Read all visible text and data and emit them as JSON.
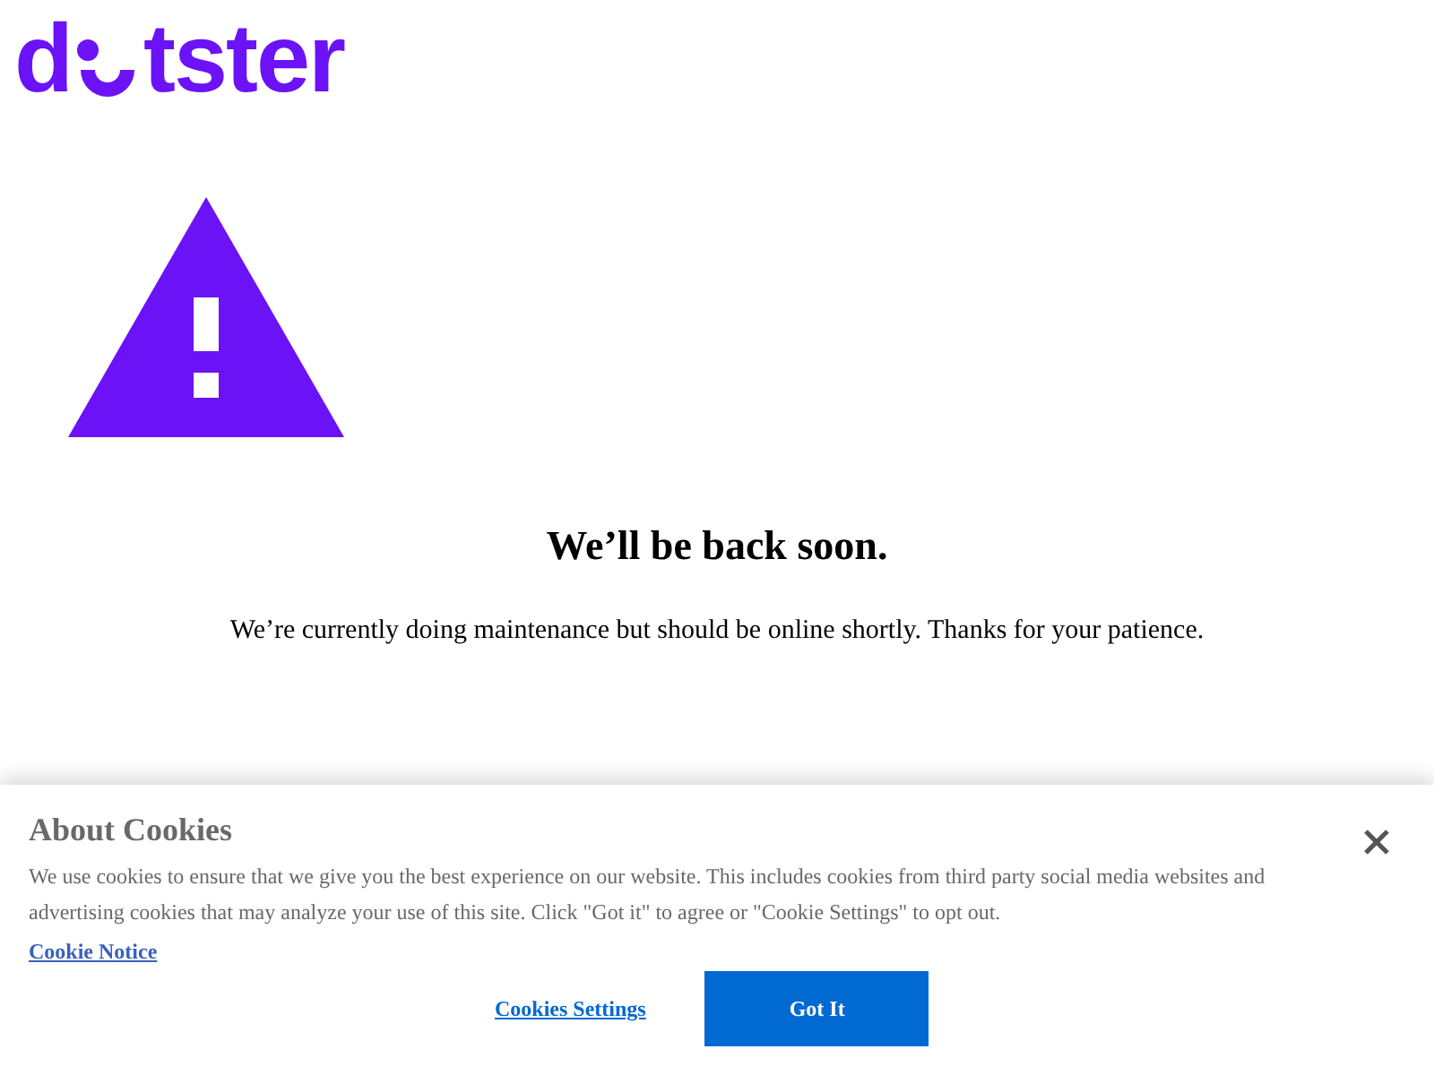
{
  "logo": {
    "before": "d",
    "after": "tster"
  },
  "heading": "We’ll be back soon.",
  "message": "We’re currently doing maintenance but should be online shortly. Thanks for your patience.",
  "cookie_banner": {
    "title": "About Cookies",
    "text": "We use cookies to ensure that we give you the best experience on our website. This includes cookies from third party social media websites and advertising cookies that may analyze your use of this site. Click \"Got it\" to agree or \"Cookie Settings\" to opt out.",
    "notice_link": "Cookie Notice",
    "settings_link": "Cookies Settings",
    "accept_button": "Got It"
  }
}
